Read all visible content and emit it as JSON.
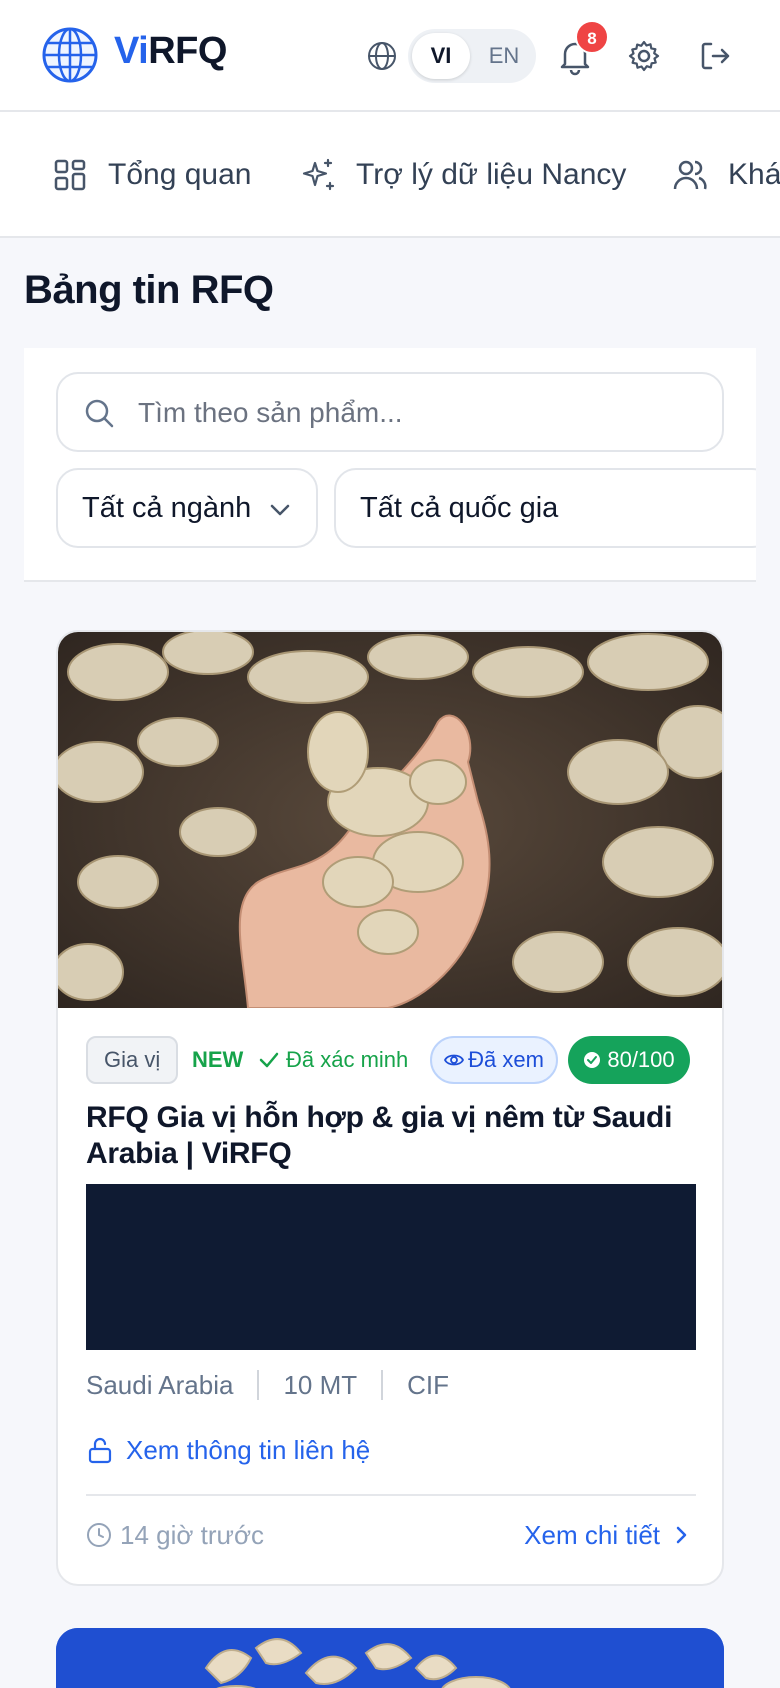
{
  "header": {
    "logo_prefix": "Vi",
    "logo_suffix": "RFQ",
    "lang_options": [
      "VI",
      "EN"
    ],
    "lang_selected": "VI",
    "notification_count": "8"
  },
  "nav": {
    "items": [
      {
        "label": "Tổng quan",
        "icon": "grid-icon"
      },
      {
        "label": "Trợ lý dữ liệu Nancy",
        "icon": "sparkle-icon"
      },
      {
        "label": "Khá",
        "icon": "users-icon"
      }
    ]
  },
  "page": {
    "title": "Bảng tin RFQ"
  },
  "filters": {
    "search_placeholder": "Tìm theo sản phẩm...",
    "search_value": "",
    "industry_select": "Tất cả ngành",
    "country_select": "Tất cả quốc gia"
  },
  "card": {
    "category": "Gia vị",
    "new_label": "NEW",
    "verified_label": "Đã xác minh",
    "viewed_label": "Đã xem",
    "score": "80/100",
    "title": "RFQ Gia vị hỗn hợp & gia vị nêm từ Saudi Arabia | ViRFQ",
    "country": "Saudi Arabia",
    "quantity": "10 MT",
    "incoterm": "CIF",
    "contact_label": "Xem thông tin liên hệ",
    "time_ago": "14 giờ trước",
    "details_label": "Xem chi tiết",
    "image_subject": "ginger-roots-photo"
  },
  "colors": {
    "brand_blue": "#2563eb",
    "success_green": "#16a34a",
    "score_green": "#15a35b",
    "badge_red": "#ef4444",
    "description_block": "#0f1b33"
  }
}
